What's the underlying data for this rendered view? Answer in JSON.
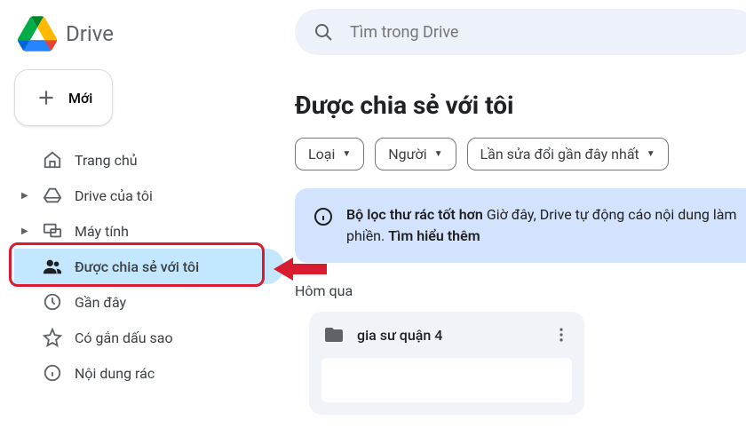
{
  "app": {
    "name": "Drive"
  },
  "search": {
    "placeholder": "Tìm trong Drive"
  },
  "new_button": {
    "label": "Mới"
  },
  "sidebar": {
    "items": [
      {
        "label": "Trang chủ"
      },
      {
        "label": "Drive của tôi"
      },
      {
        "label": "Máy tính"
      },
      {
        "label": "Được chia sẻ với tôi"
      },
      {
        "label": "Gần đây"
      },
      {
        "label": "Có gắn dấu sao"
      },
      {
        "label": "Nội dung rác"
      }
    ]
  },
  "main": {
    "title": "Được chia sẻ với tôi",
    "filters": {
      "type": "Loại",
      "people": "Người",
      "modified": "Lần sửa đổi gần đây nhất"
    },
    "banner": {
      "strong": "Bộ lọc thư rác tốt hơn",
      "text": " Giờ đây, Drive tự động cáo nội dung làm phiền. ",
      "link": "Tìm hiểu thêm"
    },
    "section": "Hôm qua",
    "folder": {
      "name": "gia sư quận 4"
    }
  }
}
